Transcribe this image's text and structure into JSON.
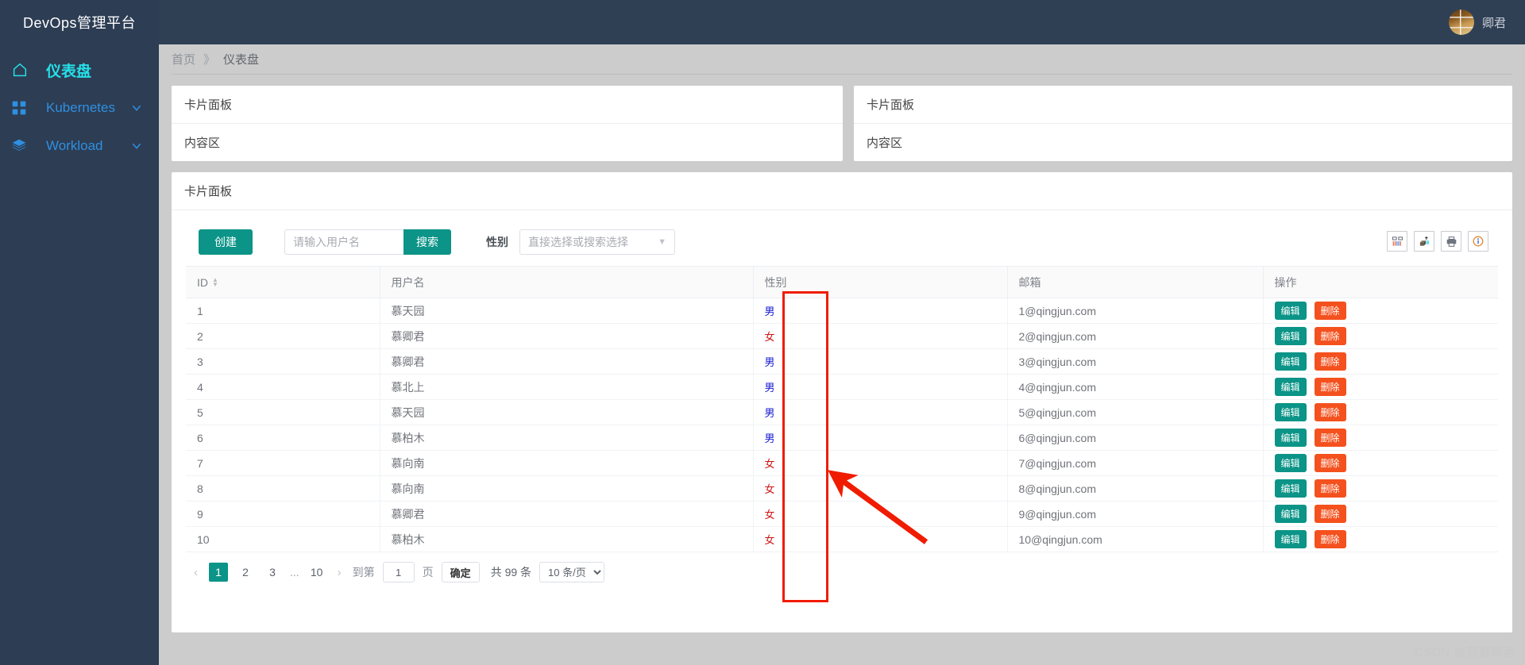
{
  "app": {
    "title": "DevOps管理平台"
  },
  "user": {
    "name": "卿君",
    "avatar_icon": "user-avatar-image"
  },
  "sidebar": {
    "items": [
      {
        "label": "仪表盘",
        "icon": "home-icon",
        "active": true,
        "expandable": false
      },
      {
        "label": "Kubernetes",
        "icon": "grid-apps-icon",
        "active": false,
        "expandable": true
      },
      {
        "label": "Workload",
        "icon": "layers-icon",
        "active": false,
        "expandable": true
      }
    ]
  },
  "breadcrumb": {
    "home": "首页",
    "separator": "》",
    "current": "仪表盘"
  },
  "cards": {
    "top_left": {
      "header": "卡片面板",
      "body": "内容区"
    },
    "top_right": {
      "header": "卡片面板",
      "body": "内容区"
    },
    "main": {
      "header": "卡片面板"
    }
  },
  "toolbar": {
    "create_label": "创建",
    "search_placeholder": "请输入用户名",
    "search_value": "",
    "search_label": "搜索",
    "gender_label": "性别",
    "gender_placeholder": "直接选择或搜索选择",
    "icons": [
      "columns-icon",
      "export-icon",
      "print-icon",
      "info-icon"
    ]
  },
  "table": {
    "columns": [
      "ID",
      "用户名",
      "性别",
      "邮箱",
      "操作"
    ],
    "sortable_column": "ID",
    "rows": [
      {
        "id": "1",
        "name": "慕天园",
        "gender": "男",
        "gender_type": "male",
        "email": "1@qingjun.com"
      },
      {
        "id": "2",
        "name": "慕卿君",
        "gender": "女",
        "gender_type": "female",
        "email": "2@qingjun.com"
      },
      {
        "id": "3",
        "name": "慕卿君",
        "gender": "男",
        "gender_type": "male",
        "email": "3@qingjun.com"
      },
      {
        "id": "4",
        "name": "慕北上",
        "gender": "男",
        "gender_type": "male",
        "email": "4@qingjun.com"
      },
      {
        "id": "5",
        "name": "慕天园",
        "gender": "男",
        "gender_type": "male",
        "email": "5@qingjun.com"
      },
      {
        "id": "6",
        "name": "慕柏木",
        "gender": "男",
        "gender_type": "male",
        "email": "6@qingjun.com"
      },
      {
        "id": "7",
        "name": "慕向南",
        "gender": "女",
        "gender_type": "female",
        "email": "7@qingjun.com"
      },
      {
        "id": "8",
        "name": "慕向南",
        "gender": "女",
        "gender_type": "female",
        "email": "8@qingjun.com"
      },
      {
        "id": "9",
        "name": "慕卿君",
        "gender": "女",
        "gender_type": "female",
        "email": "9@qingjun.com"
      },
      {
        "id": "10",
        "name": "慕柏木",
        "gender": "女",
        "gender_type": "female",
        "email": "10@qingjun.com"
      }
    ],
    "edit_label": "编辑",
    "delete_label": "删除"
  },
  "pagination": {
    "prev": "‹",
    "next": "›",
    "pages": [
      "1",
      "2",
      "3"
    ],
    "ellipsis": "...",
    "last_page": "10",
    "current_page": "1",
    "goto_prefix": "到第",
    "goto_value": "1",
    "goto_suffix": "页",
    "confirm_label": "确定",
    "total_label": "共 99 条",
    "page_size": "10 条/页"
  },
  "annotations": {
    "highlight_box": "gender-column-highlight",
    "arrow": "pointer-arrow"
  },
  "watermark": {
    "text": "CSDN @百慕卿君"
  },
  "colors": {
    "sidebar_bg": "#2d3d54",
    "topbar_bg": "#2f4055",
    "accent_teal": "#0b9487",
    "delete_orange": "#f4511e",
    "active_cyan": "#25e0e8",
    "nav_blue": "#2f8fe0",
    "annotation_red": "#f01c00",
    "male_blue": "#1418d0",
    "female_red": "#d01414"
  }
}
